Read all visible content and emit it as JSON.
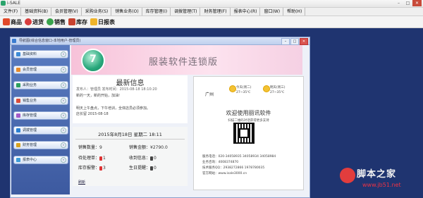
{
  "window": {
    "title": "i-SALE",
    "min": "–",
    "max": "□",
    "close": "✕"
  },
  "menu": [
    "文件(F)",
    "基础资料(B)",
    "会员管理(V)",
    "采购业务(S)",
    "销售业务(O)",
    "库存管理(I)",
    "调拨管理(T)",
    "财务管理(F)",
    "报表中心(R)",
    "窗口(W)",
    "帮助(H)"
  ],
  "toolbar": [
    {
      "label": "商品",
      "icon": "goods-icon",
      "color": "#e24a2a"
    },
    {
      "label": "进货",
      "icon": "purchase-icon",
      "color": "#d83d3d"
    },
    {
      "label": "销售",
      "icon": "sale-icon",
      "color": "#39a34b"
    },
    {
      "label": "库存",
      "icon": "stock-icon",
      "color": "#c7422f"
    },
    {
      "label": "日报表",
      "icon": "daily-report-icon",
      "color": "#f0b42a"
    }
  ],
  "child": {
    "title": "导航图(综合信息窗口-本地用户-管理员)"
  },
  "sidebar": [
    {
      "label": "基础资料"
    },
    {
      "label": "会员管理"
    },
    {
      "label": "采购业务"
    },
    {
      "label": "销售业务"
    },
    {
      "label": "库存管理"
    },
    {
      "label": "调拨管理"
    },
    {
      "label": "财务管理"
    },
    {
      "label": "报表中心"
    }
  ],
  "banner": {
    "logo": "7",
    "title": "服装软件连锁版"
  },
  "news": {
    "heading": "最新信息",
    "meta": "发布人：管理员   发布时间：2015-08-18 18:10:20",
    "lines": [
      "新的一天，新的开始，加油!",
      "",
      "明天上午盘点，下午培训，全体店员必须参加。",
      "店长留 2015-08-18"
    ]
  },
  "stats": {
    "date": "2015年8月18日 星期二 18:11",
    "sales_count_label": "销售数量：",
    "sales_count": "9",
    "sales_amount_label": "销售金额：",
    "sales_amount": "¥2790.0",
    "pending_label": "待处理单：",
    "pending": "1",
    "received_label": "收到信息：",
    "received": "0",
    "stock_alert_label": "库存报警：",
    "stock_alert": "3",
    "birthday_label": "生日提醒：",
    "birthday": "0",
    "link": "刷新"
  },
  "info": {
    "city": "广州",
    "today": "今天(周二)",
    "today_temp": "27~35℃",
    "tomorrow": "明天(周三)",
    "tomorrow_temp": "27~35℃",
    "welcome": "欢迎使用丽讯软件",
    "scan": "扫描二维码对话获得更多支持",
    "contacts": [
      "服务电话：020-34058935  34058934  34058984",
      "业务咨询：4008374870",
      "技术服务QQ：2938272866  1978780035",
      "官方网站：www.isale3000.cn"
    ]
  },
  "watermark": {
    "brand": "脚本之家",
    "url": "www.jb51.net"
  }
}
